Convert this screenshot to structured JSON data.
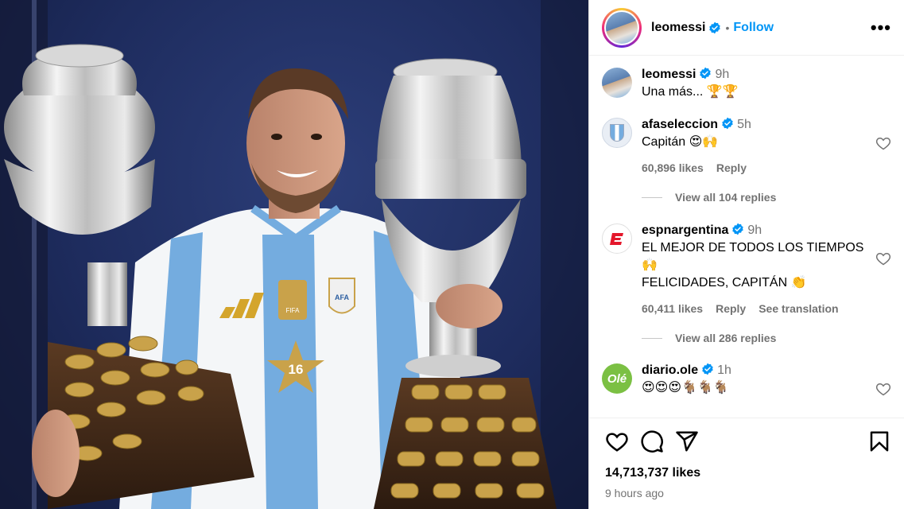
{
  "post": {
    "username": "leomessi",
    "follow_label": "Follow",
    "separator": "•",
    "more_label": "•••",
    "likes": "14,713,737 likes",
    "time_ago": "9 hours ago"
  },
  "jersey": {
    "badge": "FIFA",
    "number": "16",
    "crest": "AFA"
  },
  "comments": [
    {
      "username": "leomessi",
      "time": "9h",
      "text": "Una más... 🏆🏆"
    },
    {
      "username": "afaseleccion",
      "time": "5h",
      "text": "Capitán 😍🙌",
      "likes": "60,896 likes",
      "reply": "Reply",
      "view_replies": "View all 104 replies"
    },
    {
      "username": "espnargentina",
      "time": "9h",
      "text_line1": "EL MEJOR DE TODOS LOS TIEMPOS",
      "text_line2": "🙌",
      "text_line3": "FELICIDADES, CAPITÁN 👏",
      "likes": "60,411 likes",
      "reply": "Reply",
      "translate": "See translation",
      "view_replies": "View all 286 replies"
    },
    {
      "username": "diario.ole",
      "time": "1h",
      "text": "😍😍😍🐐🐐🐐",
      "avatar_text": "Olé"
    }
  ],
  "icons": [
    "heart-icon",
    "comment-icon",
    "share-icon",
    "bookmark-icon",
    "verified-icon",
    "more-icon"
  ],
  "colors": {
    "accent": "#0095f6",
    "verified": "#0095f6",
    "muted": "#737373",
    "border": "#dbdbdb"
  }
}
